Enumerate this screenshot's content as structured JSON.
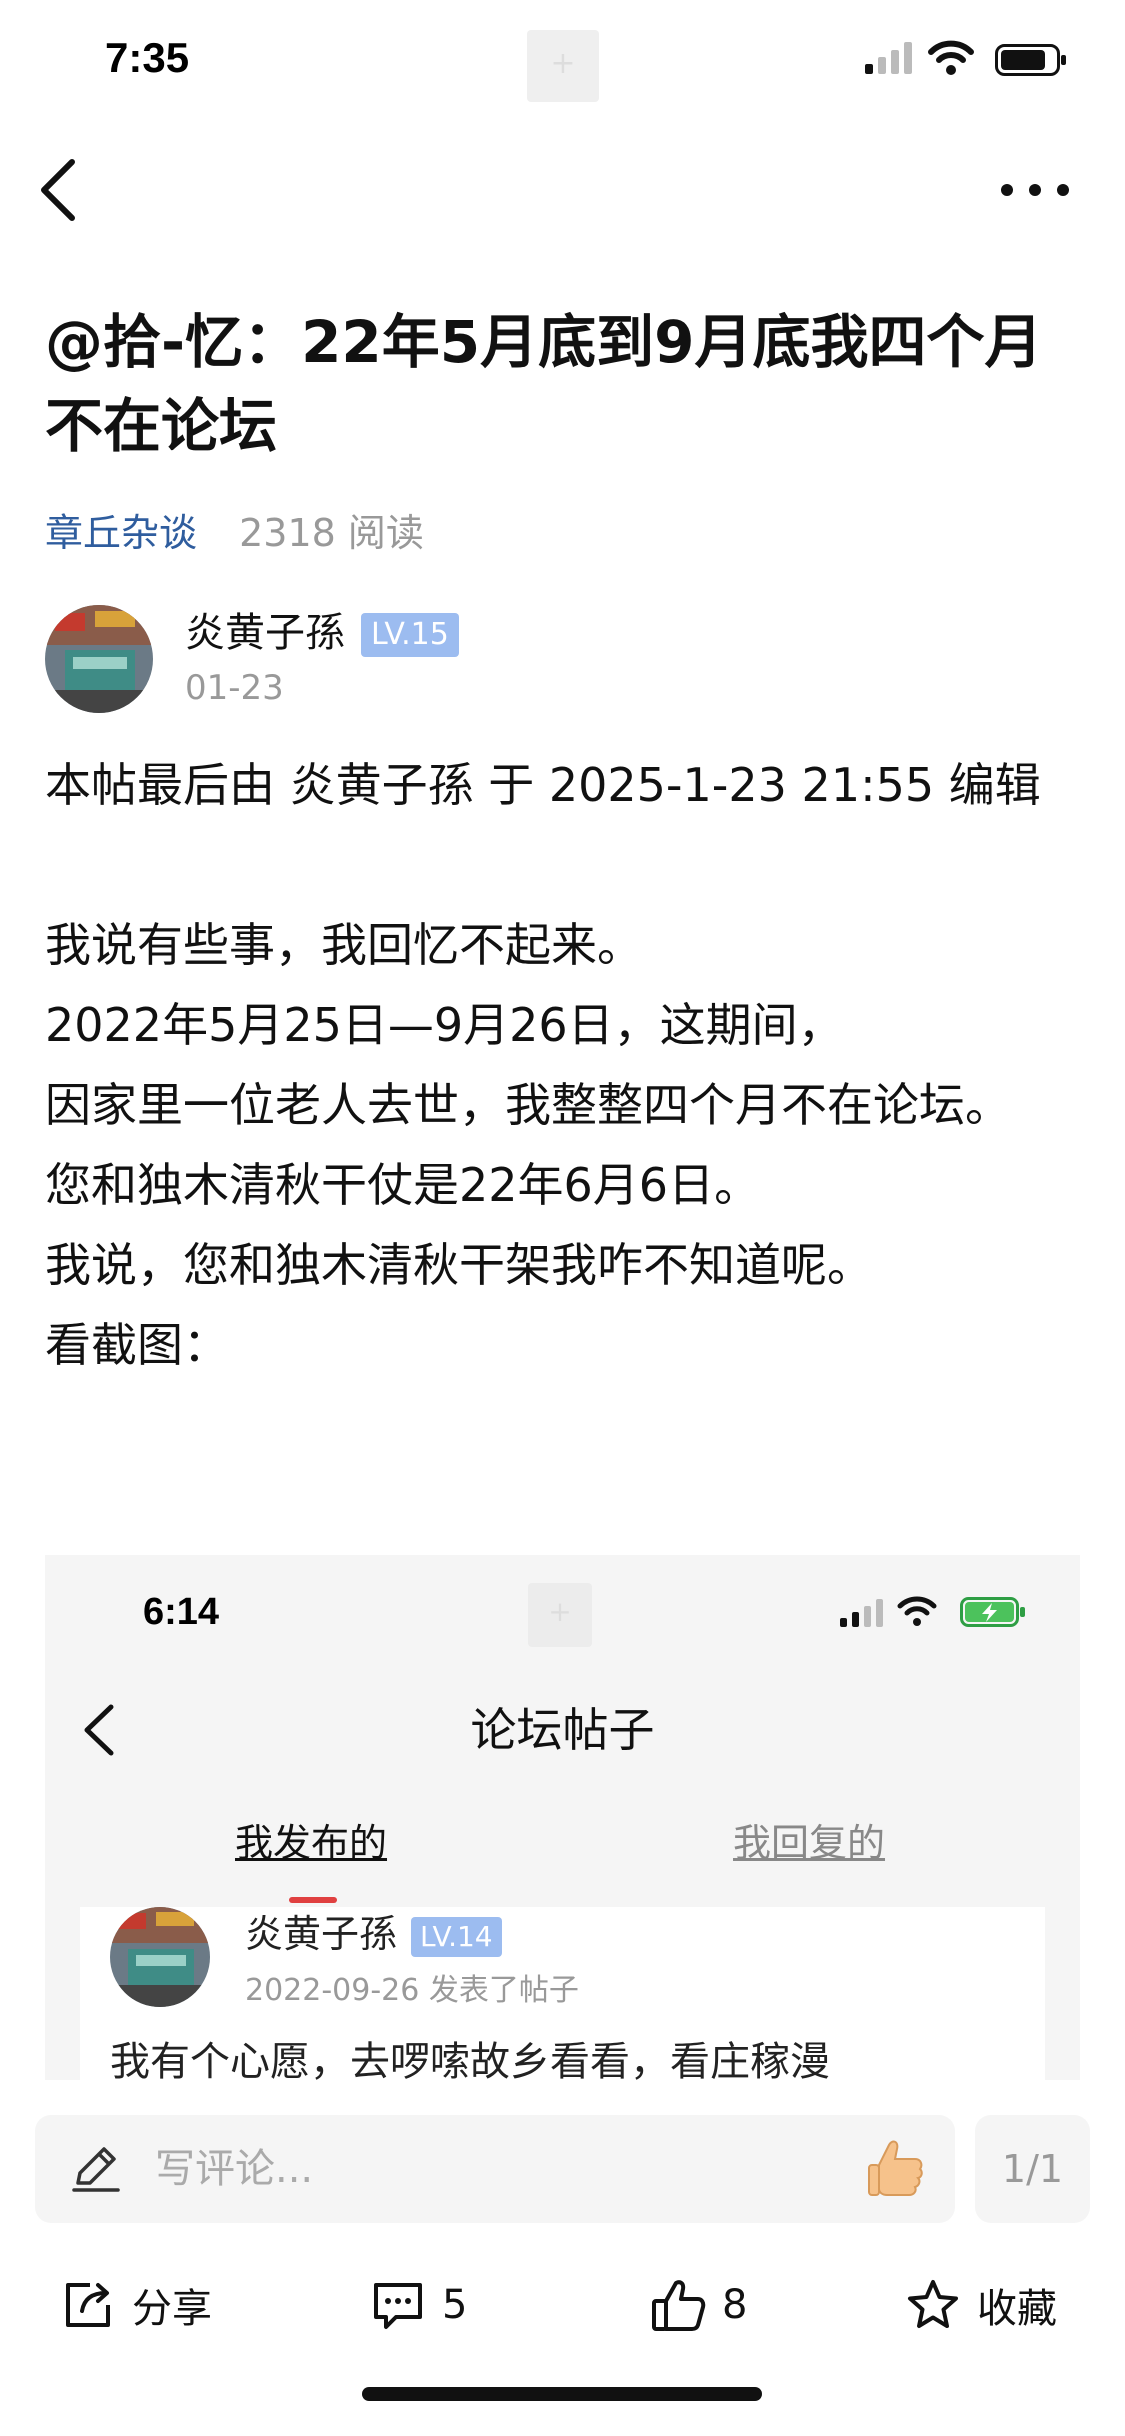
{
  "status_bar": {
    "time": "7:35"
  },
  "nav": {
    "back": "back",
    "more": "more"
  },
  "post": {
    "title": "@拾-忆：22年5月底到9月底我四个月不在论坛",
    "forum": "章丘杂谈",
    "reads": "2318 阅读",
    "author": "炎黄子孫",
    "level": "LV.15",
    "date": "01-23",
    "body": [
      "本帖最后由 炎黄子孫 于 2025-1-23 21:55 编辑",
      "",
      "我说有些事，我回忆不起来。",
      "2022年5月25日—9月26日，这期间，",
      "因家里一位老人去世，我整整四个月不在论坛。",
      "您和独木清秋干仗是22年6月6日。",
      "我说，您和独木清秋干架我咋不知道呢。",
      "看截图："
    ]
  },
  "screenshot": {
    "time": "6:14",
    "title": "论坛帖子",
    "tab_published": "我发布的",
    "tab_replied": "我回复的",
    "author": "炎黄子孫",
    "level": "LV.14",
    "date": "2022-09-26 发表了帖子",
    "content": "我有个心愿，去啰嗦故乡看看，看庄稼漫"
  },
  "bottom": {
    "comment_placeholder": "写评论...",
    "page": "1/1",
    "share": "分享",
    "comments": "5",
    "likes": "8",
    "favorite": "收藏"
  },
  "colors": {
    "link": "#2f5d9e",
    "badge": "#9cbcf0",
    "muted": "#999999"
  }
}
